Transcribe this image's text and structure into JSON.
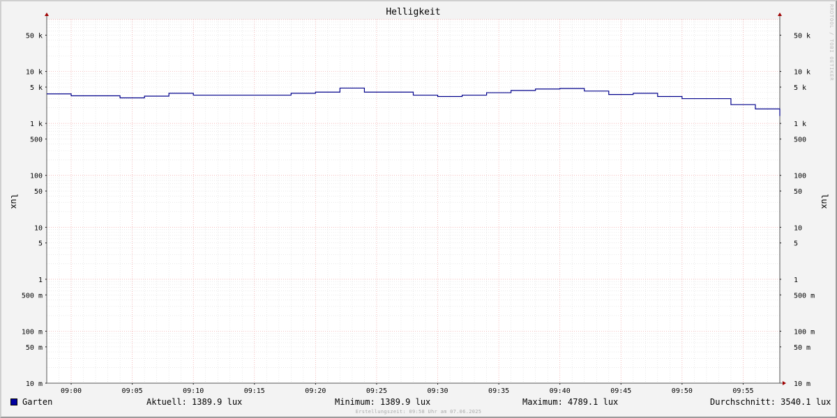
{
  "chart_data": {
    "type": "line",
    "title": "Helligkeit",
    "ylabel": "lux",
    "yscale": "log",
    "ylim": [
      0.01,
      100000
    ],
    "y_ticks": [
      {
        "value": 0.01,
        "label": "10 m"
      },
      {
        "value": 0.05,
        "label": "50 m"
      },
      {
        "value": 0.1,
        "label": "100 m"
      },
      {
        "value": 0.5,
        "label": "500 m"
      },
      {
        "value": 1,
        "label": "1"
      },
      {
        "value": 5,
        "label": "5"
      },
      {
        "value": 10,
        "label": "10"
      },
      {
        "value": 50,
        "label": "50"
      },
      {
        "value": 100,
        "label": "100"
      },
      {
        "value": 500,
        "label": "500"
      },
      {
        "value": 1000,
        "label": "1 k"
      },
      {
        "value": 5000,
        "label": "5 k"
      },
      {
        "value": 10000,
        "label": "10 k"
      },
      {
        "value": 50000,
        "label": "50 k"
      }
    ],
    "x_ticks": [
      "09:00",
      "09:05",
      "09:10",
      "09:15",
      "09:20",
      "09:25",
      "09:30",
      "09:35",
      "09:40",
      "09:45",
      "09:50",
      "09:55"
    ],
    "xlim": [
      "08:58",
      "09:58"
    ],
    "grid": true,
    "series": [
      {
        "name": "Garten",
        "color": "#00008b",
        "x": [
          "08:58",
          "09:00",
          "09:04",
          "09:06",
          "09:08",
          "09:10",
          "09:16",
          "09:18",
          "09:20",
          "09:22",
          "09:24",
          "09:28",
          "09:30",
          "09:32",
          "09:34",
          "09:36",
          "09:38",
          "09:40",
          "09:42",
          "09:44",
          "09:46",
          "09:48",
          "09:50",
          "09:54",
          "09:56",
          "09:58"
        ],
        "values": [
          3700,
          3400,
          3100,
          3350,
          3800,
          3500,
          3500,
          3800,
          4000,
          4789.1,
          4000,
          3500,
          3300,
          3500,
          3900,
          4300,
          4600,
          4700,
          4200,
          3600,
          3800,
          3300,
          3000,
          2300,
          1900,
          1389.9
        ]
      }
    ]
  },
  "legend": {
    "series_name": "Garten",
    "current": "Aktuell: 1389.9 lux",
    "minimum": "Minimum: 1389.9 lux",
    "maximum": "Maximum: 4789.1 lux",
    "average": "Durchschnitt: 3540.1 lux"
  },
  "footer": "Erstellungszeit: 09:58 Uhr am 07.06.2025",
  "watermark": "RRDTOOL / TOBI OETIKER"
}
